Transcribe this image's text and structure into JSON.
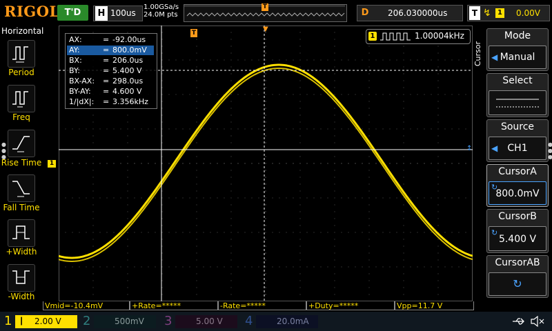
{
  "brand": "RIGOL",
  "top": {
    "run_status": "T'D",
    "timebase_label": "H",
    "timebase_value": "100us",
    "sample_rate": "1.00GSa/s",
    "mem_depth": "24.0M pts",
    "trigger_pos_marker": "T",
    "delay_label": "D",
    "delay_value": "206.030000us",
    "trigger_label": "T",
    "trigger_source": "1",
    "trigger_level": "0.00V"
  },
  "left_panel": {
    "title": "Horizontal",
    "items": [
      {
        "label": "Period",
        "icon": "period-icon"
      },
      {
        "label": "Freq",
        "icon": "freq-icon"
      },
      {
        "label": "Rise Time",
        "icon": "rise-time-icon"
      },
      {
        "label": "Fall Time",
        "icon": "fall-time-icon"
      },
      {
        "label": "+Width",
        "icon": "pos-width-icon"
      },
      {
        "label": "-Width",
        "icon": "neg-width-icon"
      }
    ]
  },
  "cursor_readout": {
    "rows": [
      {
        "label": "AX:",
        "eq": "=",
        "value": "-92.00us"
      },
      {
        "label": "AY:",
        "eq": "=",
        "value": "800.0mV"
      },
      {
        "label": "BX:",
        "eq": "=",
        "value": "206.0us"
      },
      {
        "label": "BY:",
        "eq": "=",
        "value": "5.400 V"
      },
      {
        "label": "BX-AX:",
        "eq": "=",
        "value": "298.0us"
      },
      {
        "label": "BY-AY:",
        "eq": "=",
        "value": "4.600 V"
      },
      {
        "label": "1/|dX|:",
        "eq": "=",
        "value": "3.356kHz"
      }
    ]
  },
  "frequency_counter": {
    "channel": "1",
    "value": "1.00004kHz"
  },
  "markers": {
    "trigger_top": "T",
    "channel_left": "1",
    "cursor_b_left": "T"
  },
  "measurements": [
    "Vmid=-10.4mV",
    "+Rate=*****",
    "-Rate=*****",
    "+Duty=*****",
    "Vpp=11.7 V"
  ],
  "right_panel": {
    "vertical_title": "Cursor",
    "mode": {
      "title": "Mode",
      "value": "Manual"
    },
    "select": {
      "title": "Select"
    },
    "source": {
      "title": "Source",
      "value": "CH1"
    },
    "cursor_a": {
      "title": "CursorA",
      "value": "800.0mV"
    },
    "cursor_b": {
      "title": "CursorB",
      "value": "5.400 V"
    },
    "cursor_ab": {
      "title": "CursorAB"
    }
  },
  "channels": [
    {
      "num": "1",
      "scale": "2.00 V",
      "color": "#ffe000",
      "active": true
    },
    {
      "num": "2",
      "scale": "500mV",
      "color": "#00e0e0",
      "active": false
    },
    {
      "num": "3",
      "scale": "5.00 V",
      "color": "#e040e0",
      "active": false
    },
    {
      "num": "4",
      "scale": "20.0mA",
      "color": "#3070ff",
      "active": false
    }
  ],
  "colors": {
    "ch1": "#ffe000",
    "accent": "#ff9a1a",
    "cursor": "#ffffff"
  }
}
